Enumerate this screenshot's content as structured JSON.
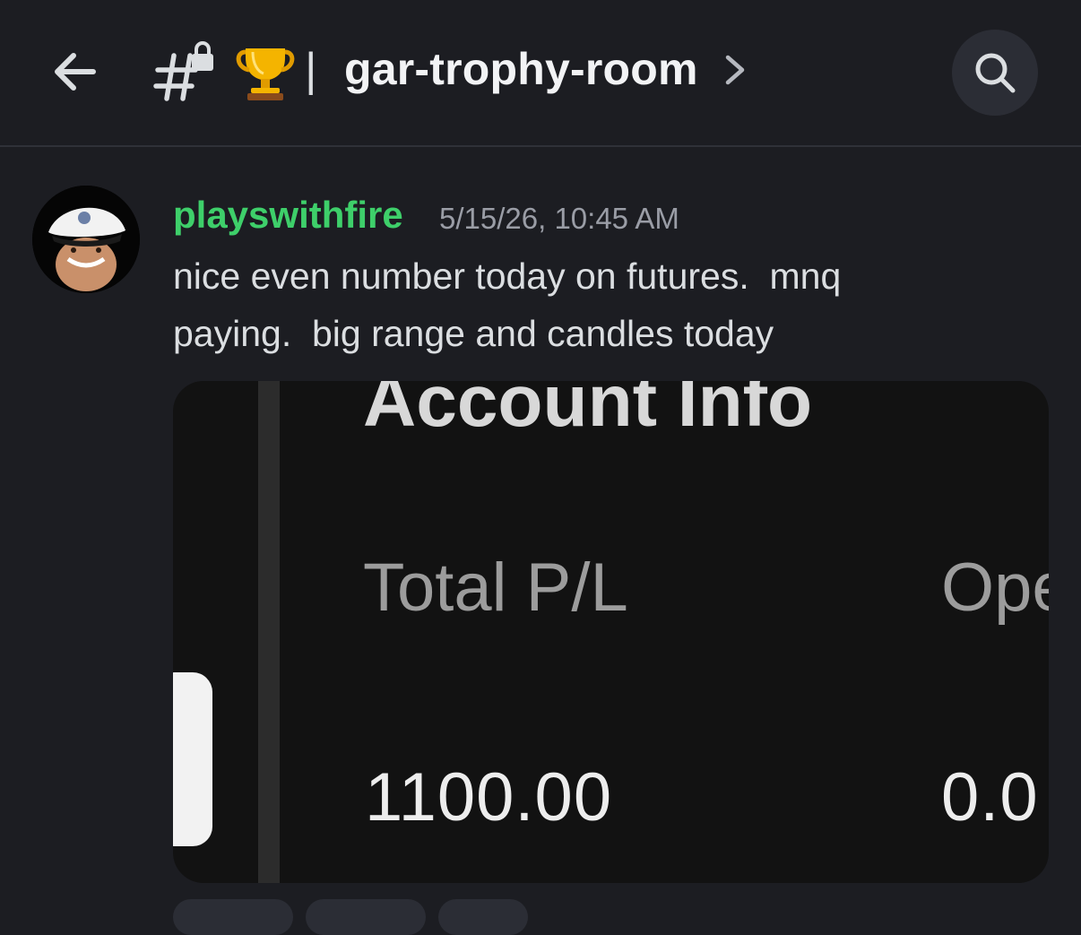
{
  "header": {
    "channel_name": "gar-trophy-room",
    "separator": "|"
  },
  "icons": {
    "back": "arrow-left-icon",
    "channel": "hash-lock-icon",
    "trophy": "trophy-icon",
    "chevron": "chevron-right-icon",
    "search": "search-icon"
  },
  "message": {
    "username": "playswithfire",
    "username_color": "#3ecf6a",
    "timestamp": "5/15/26, 10:45 AM",
    "text": "nice even number today on futures.  mnq\npaying.  big range and candles today"
  },
  "attachment": {
    "title": "Account Info",
    "label_left": "Total P/L",
    "label_right": "Ope",
    "value_left": "1100.00",
    "value_right": "0.0"
  }
}
